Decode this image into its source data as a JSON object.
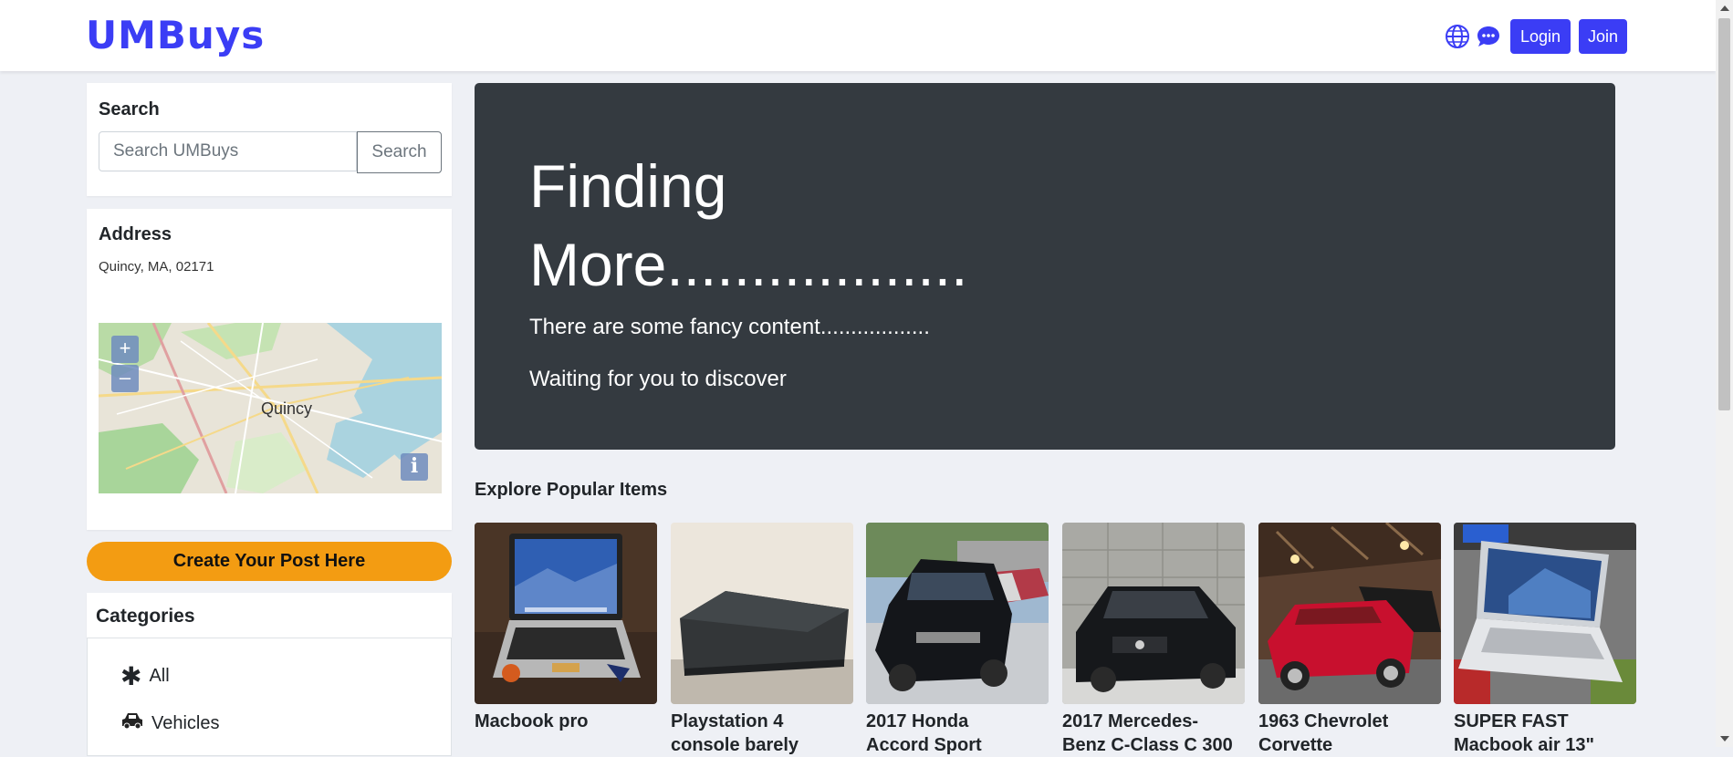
{
  "brand": "UMBuys",
  "nav": {
    "icons": [
      "globe-icon",
      "chat-icon"
    ],
    "login_label": "Login",
    "join_label": "Join"
  },
  "search": {
    "title": "Search",
    "placeholder": "Search UMBuys",
    "button_label": "Search"
  },
  "address": {
    "title": "Address",
    "value": "Quincy, MA, 02171",
    "map": {
      "label": "Quincy",
      "zoom_in": "+",
      "zoom_out": "–",
      "info": "i"
    }
  },
  "create_post_label": "Create Your Post Here",
  "categories": {
    "title": "Categories",
    "items": [
      {
        "label": "All",
        "icon": "asterisk-icon"
      },
      {
        "label": "Vehicles",
        "icon": "car-icon"
      }
    ]
  },
  "hero": {
    "title_line1": "Finding",
    "title_line2": "More..................",
    "line1": "There are some fancy content..................",
    "line2": "Waiting for you to discover"
  },
  "popular": {
    "title": "Explore Popular Items",
    "items": [
      {
        "name": "Macbook pro",
        "subtitle": ""
      },
      {
        "name": "Playstation 4",
        "subtitle": "console barely"
      },
      {
        "name": "2017 Honda",
        "subtitle": "Accord Sport"
      },
      {
        "name": "2017 Mercedes-",
        "subtitle": "Benz C-Class C 300"
      },
      {
        "name": "1963 Chevrolet",
        "subtitle": "Corvette"
      },
      {
        "name": "SUPER FAST",
        "subtitle": "Macbook air 13\""
      }
    ]
  },
  "colors": {
    "accent": "#3b3df5",
    "cta": "#f39c12",
    "hero_bg": "#343a40",
    "page_bg": "#eef0f5"
  }
}
